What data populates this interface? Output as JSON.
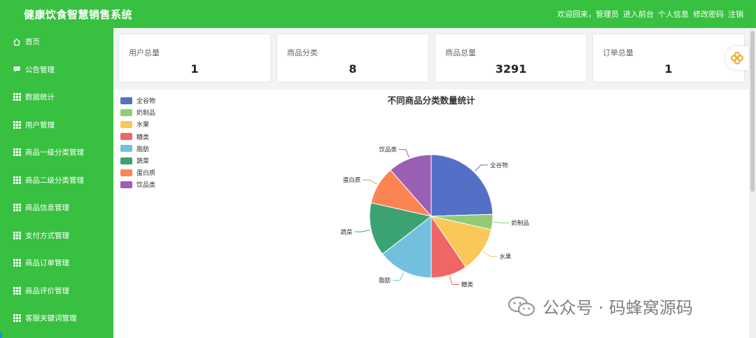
{
  "header": {
    "title": "健康饮食智慧销售系统",
    "welcome": "欢迎回来，管理员",
    "links": [
      "进入前台",
      "个人信息",
      "修改密码",
      "注销"
    ]
  },
  "sidebar": {
    "items": [
      {
        "label": "首页",
        "icon": "home-icon"
      },
      {
        "label": "公告管理",
        "icon": "chat-icon"
      },
      {
        "label": "数据统计",
        "icon": "grid-icon"
      },
      {
        "label": "用户管理",
        "icon": "grid-icon"
      },
      {
        "label": "商品一级分类管理",
        "icon": "grid-icon"
      },
      {
        "label": "商品二级分类管理",
        "icon": "grid-icon"
      },
      {
        "label": "商品信息管理",
        "icon": "grid-icon"
      },
      {
        "label": "支付方式管理",
        "icon": "grid-icon"
      },
      {
        "label": "商品订单管理",
        "icon": "grid-icon"
      },
      {
        "label": "商品评价管理",
        "icon": "grid-icon"
      },
      {
        "label": "客服关键词管理",
        "icon": "grid-icon"
      }
    ]
  },
  "stats": [
    {
      "label": "用户总量",
      "value": "1"
    },
    {
      "label": "商品分类",
      "value": "8"
    },
    {
      "label": "商品总量",
      "value": "3291"
    },
    {
      "label": "订单总量",
      "value": "1"
    }
  ],
  "watermark": {
    "text": "公众号 · 码蜂窝源码"
  },
  "colors": {
    "brand": "#38c040"
  },
  "chart_data": {
    "type": "pie",
    "title": "不同商品分类数量统计",
    "legend_position": "top-left",
    "categories": [
      "全谷物",
      "奶制品",
      "水果",
      "糖类",
      "脂肪",
      "蔬菜",
      "蛋白质",
      "饮品类"
    ],
    "values": [
      24.5,
      4,
      12,
      9.5,
      14.5,
      14,
      10,
      11.5
    ],
    "colors": [
      "#5470c6",
      "#91cc75",
      "#fac858",
      "#ee6666",
      "#73c0de",
      "#3ba272",
      "#fc8452",
      "#9a60b4"
    ]
  }
}
